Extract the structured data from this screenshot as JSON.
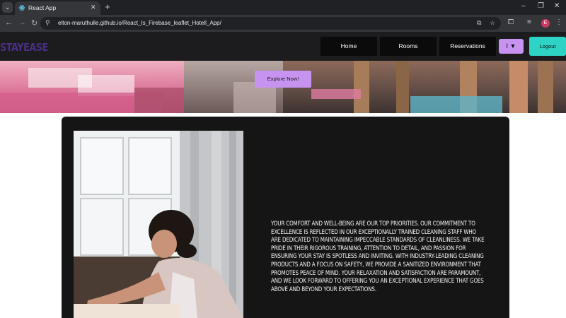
{
  "browser": {
    "tab_title": "React App",
    "url": "elton-maruthulle.github.io/React_Is_Firebase_leaflet_Hotell_App/",
    "profile_initial": "E"
  },
  "site": {
    "logo": "STAYEASE",
    "nav": [
      "Home",
      "Rooms",
      "Reservations"
    ],
    "menu_label": "I ▼",
    "logout_label": "Logout",
    "explore_label": "Explore Now!",
    "about_text": "Your comfort and well-being are our top priorities. Our commitment to excellence is reflected in our exceptionally trained cleaning staff who are dedicated to maintaining impeccable standards of cleanliness. We take pride in their rigorous training, attention to detail, and passion for ensuring your stay is spotless and inviting. With industry-leading cleaning products and a focus on safety, we provide a sanitized environment that promotes peace of mind. Your relaxation and satisfaction are paramount, and we look forward to offering you an exceptional experience that goes above and beyond your expectations."
  },
  "colors": {
    "accent_purple": "#c793f0",
    "logout_teal": "#2fd3c5",
    "logo_purple": "#4b2e86"
  }
}
